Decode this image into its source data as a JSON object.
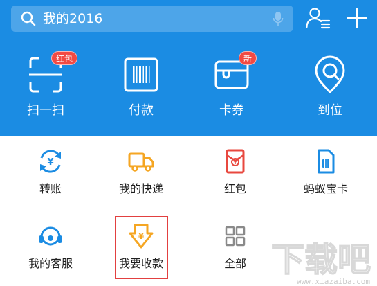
{
  "search": {
    "text": "我的2016"
  },
  "header": {
    "contacts_icon": "contacts-icon",
    "add_icon": "plus-icon"
  },
  "top_actions": [
    {
      "label": "扫一扫",
      "icon": "scan-icon",
      "badge": "红包"
    },
    {
      "label": "付款",
      "icon": "barcode-icon",
      "badge": ""
    },
    {
      "label": "卡券",
      "icon": "card-coupon-icon",
      "badge": "新"
    },
    {
      "label": "到位",
      "icon": "location-pin-icon",
      "badge": ""
    }
  ],
  "grid_items": [
    {
      "label": "转账",
      "icon": "transfer-icon"
    },
    {
      "label": "我的快递",
      "icon": "delivery-truck-icon"
    },
    {
      "label": "红包",
      "icon": "red-envelope-icon"
    },
    {
      "label": "蚂蚁宝卡",
      "icon": "sim-card-icon"
    },
    {
      "label": "我的客服",
      "icon": "customer-service-icon"
    },
    {
      "label": "我要收款",
      "icon": "receive-payment-icon"
    },
    {
      "label": "全部",
      "icon": "grid-all-icon"
    }
  ],
  "watermark": {
    "text": "下载吧",
    "url_text": "www.xiazaiba.com"
  },
  "colors": {
    "brand_blue": "#1b8ce3",
    "badge_red": "#f24a43",
    "icon_blue": "#1b8ce3",
    "icon_orange": "#f5a623",
    "highlight_red": "#e24040"
  }
}
